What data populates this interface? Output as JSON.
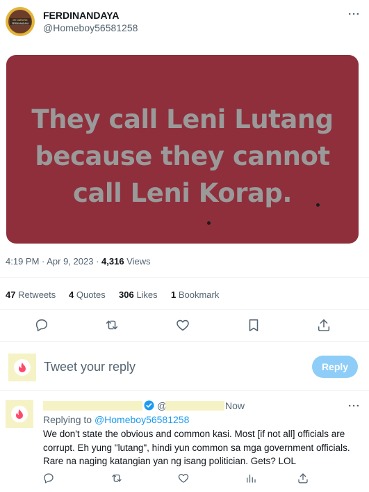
{
  "author": {
    "name": "FERDINANDAYA",
    "handle": "@Homeboy56581258"
  },
  "avatar_text": {
    "line1": "MY DARLING",
    "line2": "FERDINANDAYA"
  },
  "more_icon": "more-horizontal-icon",
  "media": {
    "text_lines": [
      "They call Leni Lutang",
      "because they cannot",
      "call Leni Korap."
    ]
  },
  "meta": {
    "time": "4:19 PM · Apr 9, 2023 · ",
    "views_count": "4,316",
    "views_label": " Views"
  },
  "stats": {
    "retweets_count": "47",
    "retweets_label": " Retweets",
    "quotes_count": "4",
    "quotes_label": " Quotes",
    "likes_count": "306",
    "likes_label": " Likes",
    "bookmarks_count": "1",
    "bookmarks_label": " Bookmark"
  },
  "actions": [
    "reply-icon",
    "retweet-icon",
    "like-icon",
    "bookmark-icon",
    "share-icon"
  ],
  "compose": {
    "placeholder": "Tweet your reply",
    "button": "Reply"
  },
  "reply": {
    "at": "@",
    "time": "Now",
    "replying_label": "Replying to ",
    "replying_handle": "@Homeboy56581258",
    "body": "We don't state the obvious and common kasi. Most [if not all] officials are corrupt. Eh yung \"lutang\", hindi yun common sa mga government officials. Rare na naging katangian yan ng isang politician. Gets? LOL"
  },
  "colors": {
    "media_bg": "#8f2f3c",
    "accent": "#1d9bf0",
    "redaction": "#f5f3c6",
    "verified": "#1d9bf0"
  }
}
